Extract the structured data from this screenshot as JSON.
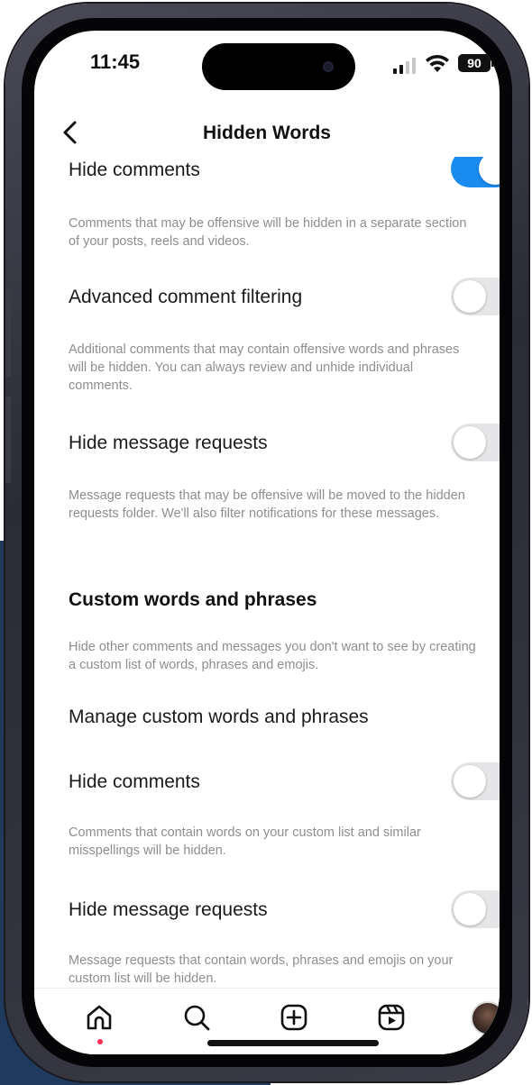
{
  "status_bar": {
    "time": "11:45",
    "battery": "90"
  },
  "header": {
    "title": "Hidden Words"
  },
  "settings": {
    "hide_comments": {
      "label": "Hide comments",
      "description": "Comments that may be offensive will be hidden in a separate section of your posts, reels and videos.",
      "enabled": true
    },
    "advanced_filtering": {
      "label": "Advanced comment filtering",
      "description": "Additional comments that may contain offensive words and phrases will be hidden. You can always review and unhide individual comments.",
      "enabled": false
    },
    "hide_message_requests": {
      "label": "Hide message requests",
      "description": "Message requests that may be offensive will be moved to the hidden requests folder. We'll also filter notifications for these messages.",
      "enabled": false
    }
  },
  "custom": {
    "section_title": "Custom words and phrases",
    "section_description": "Hide other comments and messages you don't want to see by creating a custom list of words, phrases and emojis.",
    "manage_label": "Manage custom words and phrases",
    "hide_comments": {
      "label": "Hide comments",
      "description": "Comments that contain words on your custom list and similar misspellings will be hidden.",
      "enabled": false
    },
    "hide_message_requests": {
      "label": "Hide message requests",
      "description": "Message requests that contain words, phrases and emojis on your custom list will be hidden.",
      "enabled": false
    }
  },
  "tab_bar": {
    "items": [
      {
        "icon": "home-icon",
        "notification": true
      },
      {
        "icon": "search-icon",
        "notification": false
      },
      {
        "icon": "create-icon",
        "notification": false
      },
      {
        "icon": "reels-icon",
        "notification": false
      },
      {
        "icon": "profile-avatar",
        "notification": true
      }
    ]
  },
  "colors": {
    "toggle_on": "#1a8cf0",
    "toggle_off": "#e6e6e8",
    "notification_dot": "#ff2d55",
    "description_text": "#8e8e8e",
    "background_navy": "#1f3a5c"
  }
}
